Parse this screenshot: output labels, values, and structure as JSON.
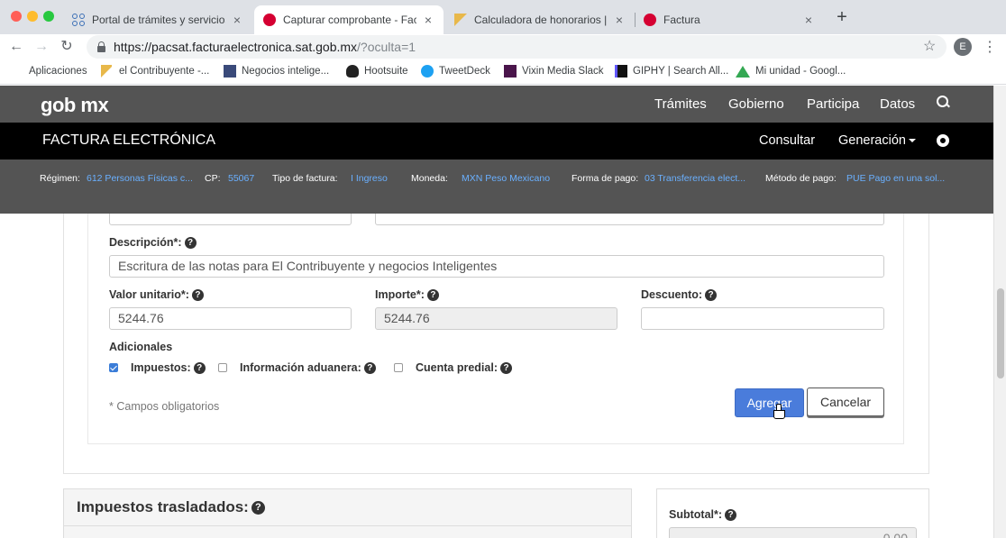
{
  "browser": {
    "tabs": [
      {
        "label": "Portal de trámites y servicios - ..."
      },
      {
        "label": "Capturar comprobante - Factu..."
      },
      {
        "label": "Calculadora de honorarios | el ..."
      },
      {
        "label": "Factura"
      }
    ],
    "url_main": "https://pacsat.facturaelectronica.sat.gob.mx",
    "url_rest": "/?oculta=1",
    "profile_initial": "E",
    "bookmarks": [
      {
        "label": "Aplicaciones"
      },
      {
        "label": "el Contribuyente -..."
      },
      {
        "label": "Negocios intelige..."
      },
      {
        "label": "Hootsuite"
      },
      {
        "label": "TweetDeck"
      },
      {
        "label": "Vixin Media Slack"
      },
      {
        "label": "GIPHY | Search All..."
      },
      {
        "label": "Mi unidad - Googl..."
      }
    ]
  },
  "gob": {
    "logo": "gob mx",
    "nav": [
      "Trámites",
      "Gobierno",
      "Participa",
      "Datos"
    ]
  },
  "fe": {
    "title": "FACTURA ELECTRÓNICA",
    "consultar": "Consultar",
    "generacion": "Generación"
  },
  "info": {
    "regimen_label": "Régimen:",
    "regimen_value": "612 Personas Físicas c...",
    "cp_label": "CP:",
    "cp_value": "55067",
    "tipo_label": "Tipo de factura:",
    "tipo_value": "I Ingreso",
    "moneda_label": "Moneda:",
    "moneda_value": "MXN Peso Mexicano",
    "forma_label": "Forma de pago:",
    "forma_value": "03 Transferencia elect...",
    "metodo_label": "Método de pago:",
    "metodo_value": "PUE Pago en una sol..."
  },
  "form": {
    "descripcion_label": "Descripción*:",
    "descripcion_value": "Escritura de las notas para El Contribuyente y negocios Inteligentes",
    "valor_label": "Valor unitario*:",
    "valor_value": "5244.76",
    "importe_label": "Importe*:",
    "importe_value": "5244.76",
    "descuento_label": "Descuento:",
    "descuento_value": "",
    "adicionales_label": "Adicionales",
    "impuestos_label": "Impuestos:",
    "aduanera_label": "Información aduanera:",
    "predial_label": "Cuenta predial:",
    "impuestos_checked": true,
    "aduanera_checked": false,
    "predial_checked": false,
    "required_note": "* Campos obligatorios",
    "agregar": "Agregar",
    "cancelar": "Cancelar"
  },
  "impuestos": {
    "title": "Impuestos trasladados:"
  },
  "totales": {
    "subtotal_label": "Subtotal*:",
    "subtotal_value": "0.00"
  },
  "colors": {
    "gob_bar": "#545454",
    "fe_bar": "#000000",
    "link_blue": "#6ab0ff",
    "primary_button": "#4a7cdb"
  }
}
